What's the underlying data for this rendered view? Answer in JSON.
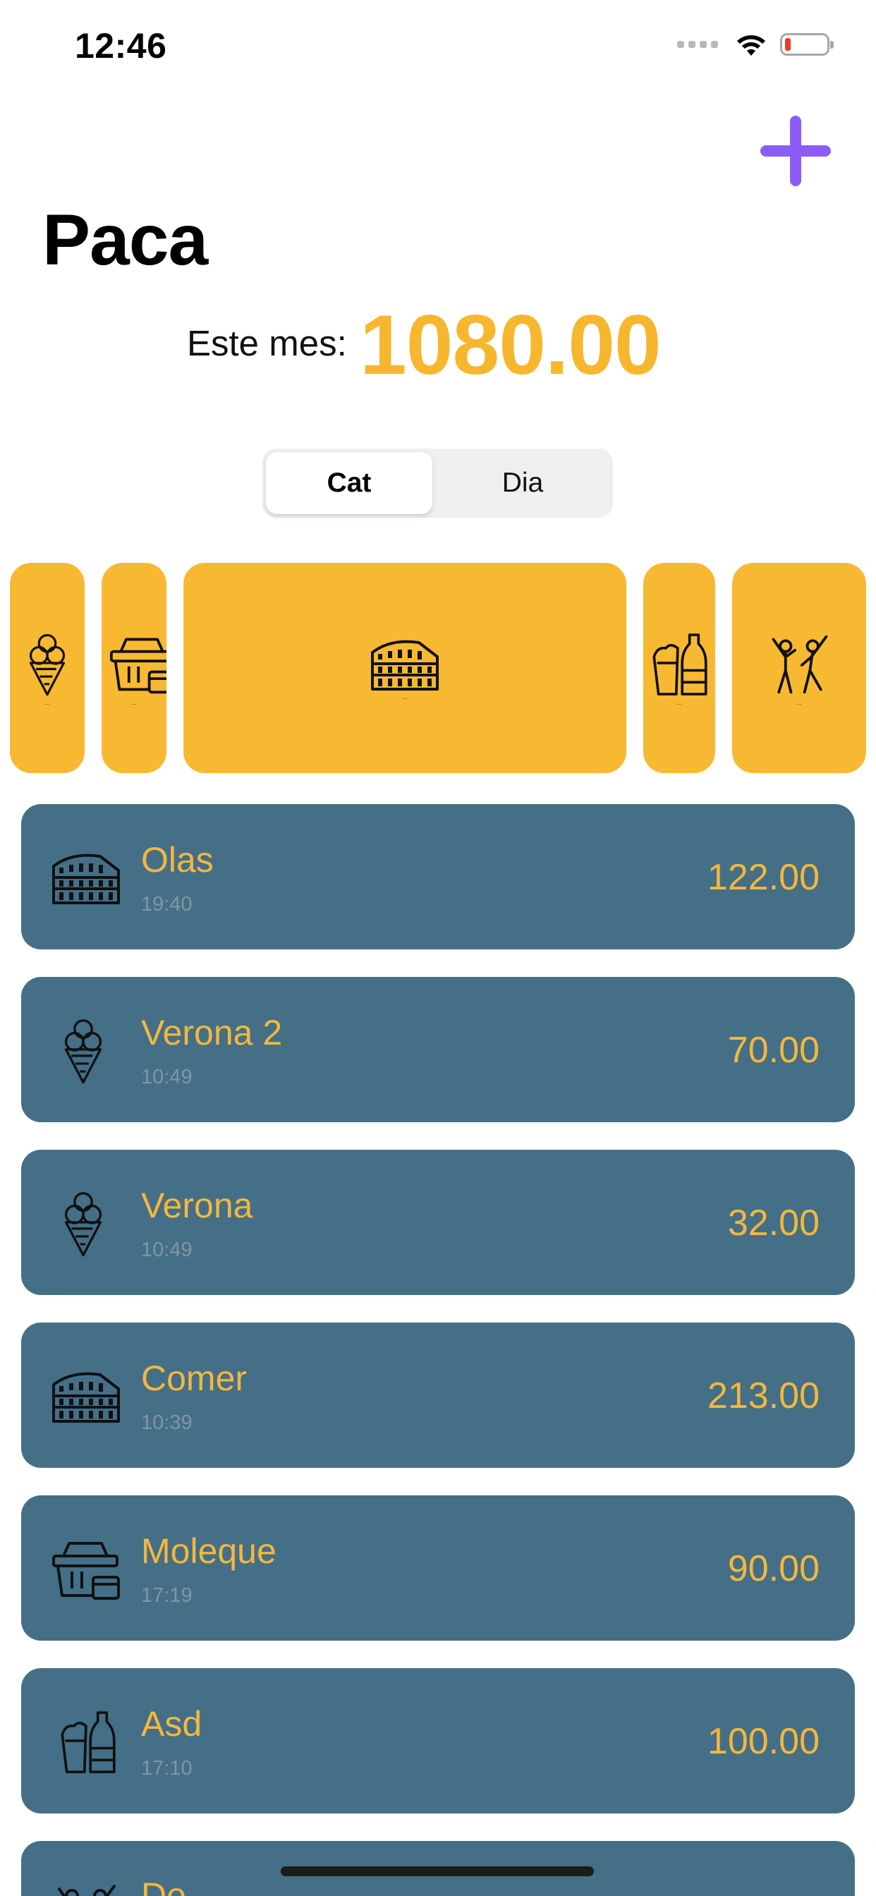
{
  "status_bar": {
    "time": "12:46"
  },
  "header": {
    "title": "Paca",
    "add_icon": "plus-icon",
    "month_label": "Este mes:",
    "month_total": "1080.00"
  },
  "segmented": {
    "options": [
      "Cat",
      "Dia"
    ],
    "selected": "Cat"
  },
  "categories": [
    {
      "icon": "ice-cream-icon",
      "label": "..."
    },
    {
      "icon": "shopping-basket-icon",
      "label": "..."
    },
    {
      "icon": "colosseum-icon",
      "label": "..."
    },
    {
      "icon": "fast-food-icon",
      "label": "..."
    },
    {
      "icon": "party-people-icon",
      "label": "..."
    }
  ],
  "expenses": [
    {
      "name": "Olas",
      "time": "19:40",
      "amount": "122.00",
      "icon": "colosseum-icon"
    },
    {
      "name": "Verona 2",
      "time": "10:49",
      "amount": "70.00",
      "icon": "ice-cream-icon"
    },
    {
      "name": "Verona",
      "time": "10:49",
      "amount": "32.00",
      "icon": "ice-cream-icon"
    },
    {
      "name": "Comer",
      "time": "10:39",
      "amount": "213.00",
      "icon": "colosseum-icon"
    },
    {
      "name": "Moleque",
      "time": "17:19",
      "amount": "90.00",
      "icon": "shopping-basket-icon"
    },
    {
      "name": "Asd",
      "time": "17:10",
      "amount": "100.00",
      "icon": "fast-food-icon"
    },
    {
      "name": "De",
      "time": "",
      "amount": "",
      "icon": "party-people-icon"
    }
  ],
  "colors": {
    "accent": "#f8b932",
    "row_background": "#446f87",
    "add_button": "#8d5cf6",
    "row_text": "#f4b73d"
  }
}
